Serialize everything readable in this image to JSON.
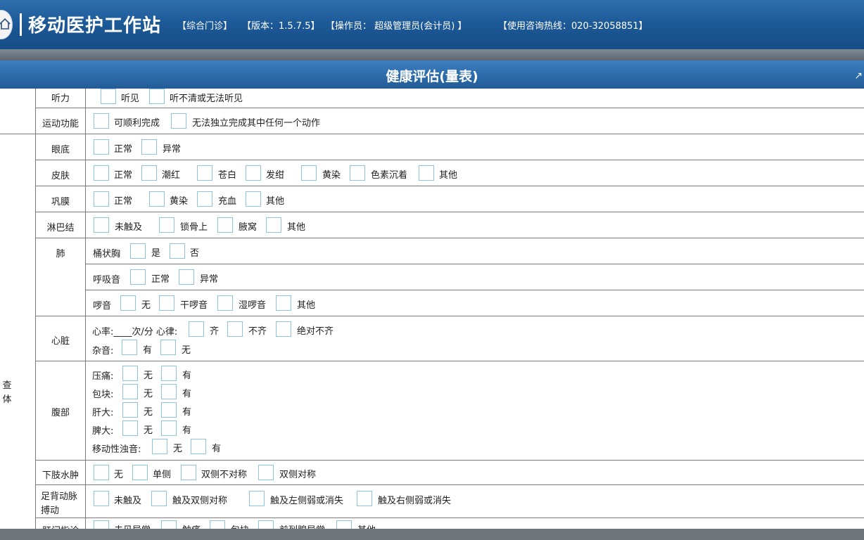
{
  "header": {
    "title": "移动医护工作站",
    "dept": "【综合门诊】",
    "version": "【版本：1.5.7.5】",
    "operator": "【操作员：  超级管理员(会计员) 】",
    "hotline": "【使用咨询热线：020-32058851】"
  },
  "panel": {
    "title": "健康评估(量表)"
  },
  "group": {
    "label": "查体"
  },
  "rows": {
    "hearing": {
      "label": "听力",
      "options": [
        "听见",
        "听不清或无法听见"
      ]
    },
    "motor": {
      "label": "运动功能",
      "options": [
        "可顺利完成",
        "无法独立完成其中任何一个动作"
      ]
    },
    "fundus": {
      "label": "眼底",
      "options": [
        "正常",
        "异常"
      ]
    },
    "skin": {
      "label": "皮肤",
      "options": [
        "正常",
        "潮红",
        "苍白",
        "发绀",
        "黄染",
        "色素沉着",
        "其他"
      ]
    },
    "sclera": {
      "label": "巩膜",
      "options": [
        "正常",
        "黄染",
        "充血",
        "其他"
      ]
    },
    "lymph": {
      "label": "淋巴结",
      "options": [
        "未触及",
        "锁骨上",
        "腋窝",
        "其他"
      ]
    },
    "lung": {
      "label": "肺",
      "barrel_label": "桶状胸",
      "barrel_options": [
        "是",
        "否"
      ],
      "breath_label": "呼吸音",
      "breath_options": [
        "正常",
        "异常"
      ],
      "rale_label": "啰音",
      "rale_options": [
        "无",
        "干啰音",
        "湿啰音",
        "其他"
      ]
    },
    "heart": {
      "label": "心脏",
      "rate_text": "心率:____次/分  心律:",
      "rhythm_options": [
        "齐",
        "不齐",
        "绝对不齐"
      ],
      "murmur_label": "杂音:",
      "murmur_options": [
        "有",
        "无"
      ]
    },
    "abdomen": {
      "label": "腹部",
      "items": [
        {
          "label": "压痛:",
          "options": [
            "无",
            "有"
          ]
        },
        {
          "label": "包块:",
          "options": [
            "无",
            "有"
          ]
        },
        {
          "label": "肝大:",
          "options": [
            "无",
            "有"
          ]
        },
        {
          "label": "脾大:",
          "options": [
            "无",
            "有"
          ]
        },
        {
          "label": "移动性浊音:",
          "options": [
            "无",
            "有"
          ]
        }
      ]
    },
    "edema": {
      "label": "下肢水肿",
      "options": [
        "无",
        "单侧",
        "双侧不对称",
        "双侧对称"
      ]
    },
    "pulse": {
      "label_line1": "足背动脉",
      "label_line2": "搏动",
      "options": [
        "未触及",
        "触及双侧对称",
        "触及左侧弱或消失",
        "触及右侧弱或消失"
      ]
    },
    "anal": {
      "label": "肛门指诊",
      "options": [
        "未见异常",
        "触痛",
        "包块",
        "前列腺异常",
        "其他"
      ]
    }
  }
}
